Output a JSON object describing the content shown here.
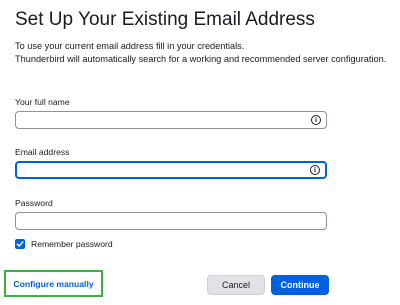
{
  "page": {
    "title": "Set Up Your Existing Email Address",
    "intro_line1": "To use your current email address fill in your credentials.",
    "intro_line2": "Thunderbird will automatically search for a working and recommended server configuration."
  },
  "form": {
    "full_name": {
      "label": "Your full name",
      "value": "",
      "placeholder": ""
    },
    "email": {
      "label": "Email address",
      "value": "",
      "placeholder": ""
    },
    "password": {
      "label": "Password",
      "value": "",
      "placeholder": ""
    },
    "remember_password": {
      "label": "Remember password",
      "checked": true
    }
  },
  "actions": {
    "configure_manually": "Configure manually",
    "cancel": "Cancel",
    "continue": "Continue"
  },
  "icons": {
    "info": "info-icon",
    "check": "checkmark-icon"
  },
  "colors": {
    "accent": "#0061e0",
    "highlight_border": "#3cb043"
  }
}
